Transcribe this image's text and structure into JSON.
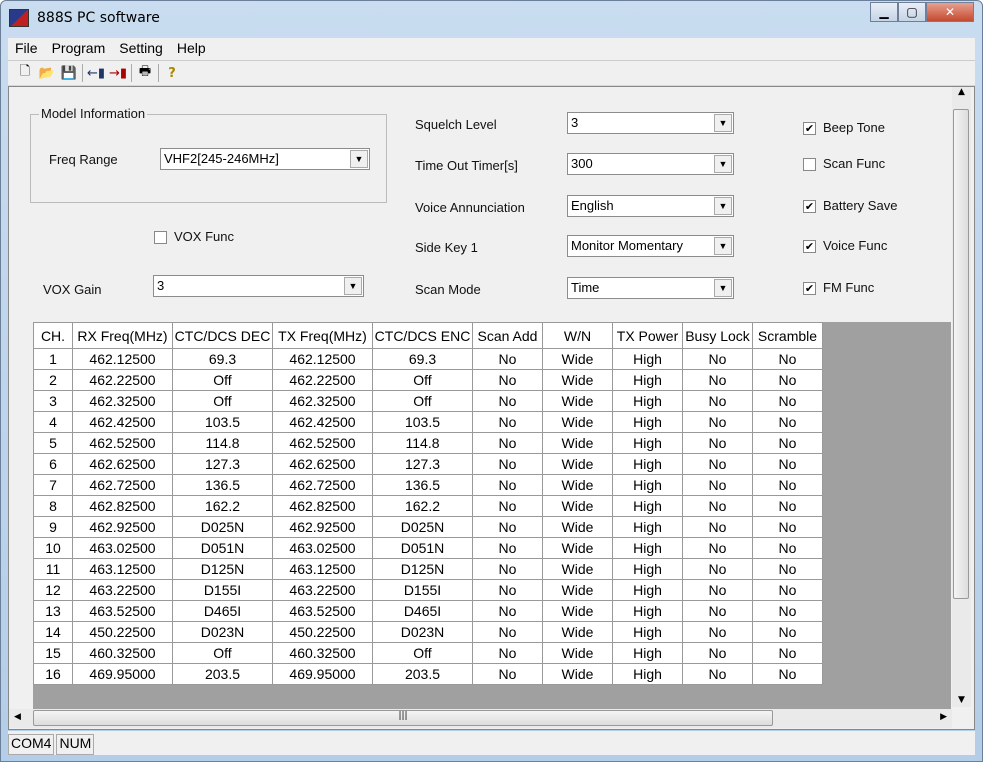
{
  "window": {
    "title": "888S PC software"
  },
  "menu": [
    "File",
    "Program",
    "Setting",
    "Help"
  ],
  "toolbar": [
    "new-icon",
    "open-icon",
    "save-icon",
    "read-from-radio-icon",
    "write-to-radio-icon",
    "print-icon",
    "help-icon"
  ],
  "model": {
    "group_label": "Model Information",
    "freq_range_label": "Freq Range",
    "freq_range": "VHF2[245-246MHz]"
  },
  "vox": {
    "func_label": "VOX Func",
    "func_checked": false,
    "gain_label": "VOX Gain",
    "gain": "3"
  },
  "settings": [
    {
      "label": "Squelch Level",
      "value": "3"
    },
    {
      "label": "Time Out Timer[s]",
      "value": "300"
    },
    {
      "label": "Voice Annunciation",
      "value": "English"
    },
    {
      "label": "Side Key 1",
      "value": "Monitor Momentary"
    },
    {
      "label": "Scan Mode",
      "value": "Time"
    }
  ],
  "checks": [
    {
      "label": "Beep Tone",
      "checked": true
    },
    {
      "label": "Scan Func",
      "checked": false
    },
    {
      "label": "Battery Save",
      "checked": true
    },
    {
      "label": "Voice Func",
      "checked": true
    },
    {
      "label": "FM Func",
      "checked": true
    }
  ],
  "table": {
    "headers": [
      "CH.",
      "RX Freq(MHz)",
      "CTC/DCS DEC",
      "TX Freq(MHz)",
      "CTC/DCS ENC",
      "Scan Add",
      "W/N",
      "TX Power",
      "Busy Lock",
      "Scramble"
    ],
    "rows": [
      [
        "1",
        "462.12500",
        "69.3",
        "462.12500",
        "69.3",
        "No",
        "Wide",
        "High",
        "No",
        "No"
      ],
      [
        "2",
        "462.22500",
        "Off",
        "462.22500",
        "Off",
        "No",
        "Wide",
        "High",
        "No",
        "No"
      ],
      [
        "3",
        "462.32500",
        "Off",
        "462.32500",
        "Off",
        "No",
        "Wide",
        "High",
        "No",
        "No"
      ],
      [
        "4",
        "462.42500",
        "103.5",
        "462.42500",
        "103.5",
        "No",
        "Wide",
        "High",
        "No",
        "No"
      ],
      [
        "5",
        "462.52500",
        "114.8",
        "462.52500",
        "114.8",
        "No",
        "Wide",
        "High",
        "No",
        "No"
      ],
      [
        "6",
        "462.62500",
        "127.3",
        "462.62500",
        "127.3",
        "No",
        "Wide",
        "High",
        "No",
        "No"
      ],
      [
        "7",
        "462.72500",
        "136.5",
        "462.72500",
        "136.5",
        "No",
        "Wide",
        "High",
        "No",
        "No"
      ],
      [
        "8",
        "462.82500",
        "162.2",
        "462.82500",
        "162.2",
        "No",
        "Wide",
        "High",
        "No",
        "No"
      ],
      [
        "9",
        "462.92500",
        "D025N",
        "462.92500",
        "D025N",
        "No",
        "Wide",
        "High",
        "No",
        "No"
      ],
      [
        "10",
        "463.02500",
        "D051N",
        "463.02500",
        "D051N",
        "No",
        "Wide",
        "High",
        "No",
        "No"
      ],
      [
        "11",
        "463.12500",
        "D125N",
        "463.12500",
        "D125N",
        "No",
        "Wide",
        "High",
        "No",
        "No"
      ],
      [
        "12",
        "463.22500",
        "D155I",
        "463.22500",
        "D155I",
        "No",
        "Wide",
        "High",
        "No",
        "No"
      ],
      [
        "13",
        "463.52500",
        "D465I",
        "463.52500",
        "D465I",
        "No",
        "Wide",
        "High",
        "No",
        "No"
      ],
      [
        "14",
        "450.22500",
        "D023N",
        "450.22500",
        "D023N",
        "No",
        "Wide",
        "High",
        "No",
        "No"
      ],
      [
        "15",
        "460.32500",
        "Off",
        "460.32500",
        "Off",
        "No",
        "Wide",
        "High",
        "No",
        "No"
      ],
      [
        "16",
        "469.95000",
        "203.5",
        "469.95000",
        "203.5",
        "No",
        "Wide",
        "High",
        "No",
        "No"
      ]
    ]
  },
  "status": [
    "COM4",
    "NUM"
  ]
}
